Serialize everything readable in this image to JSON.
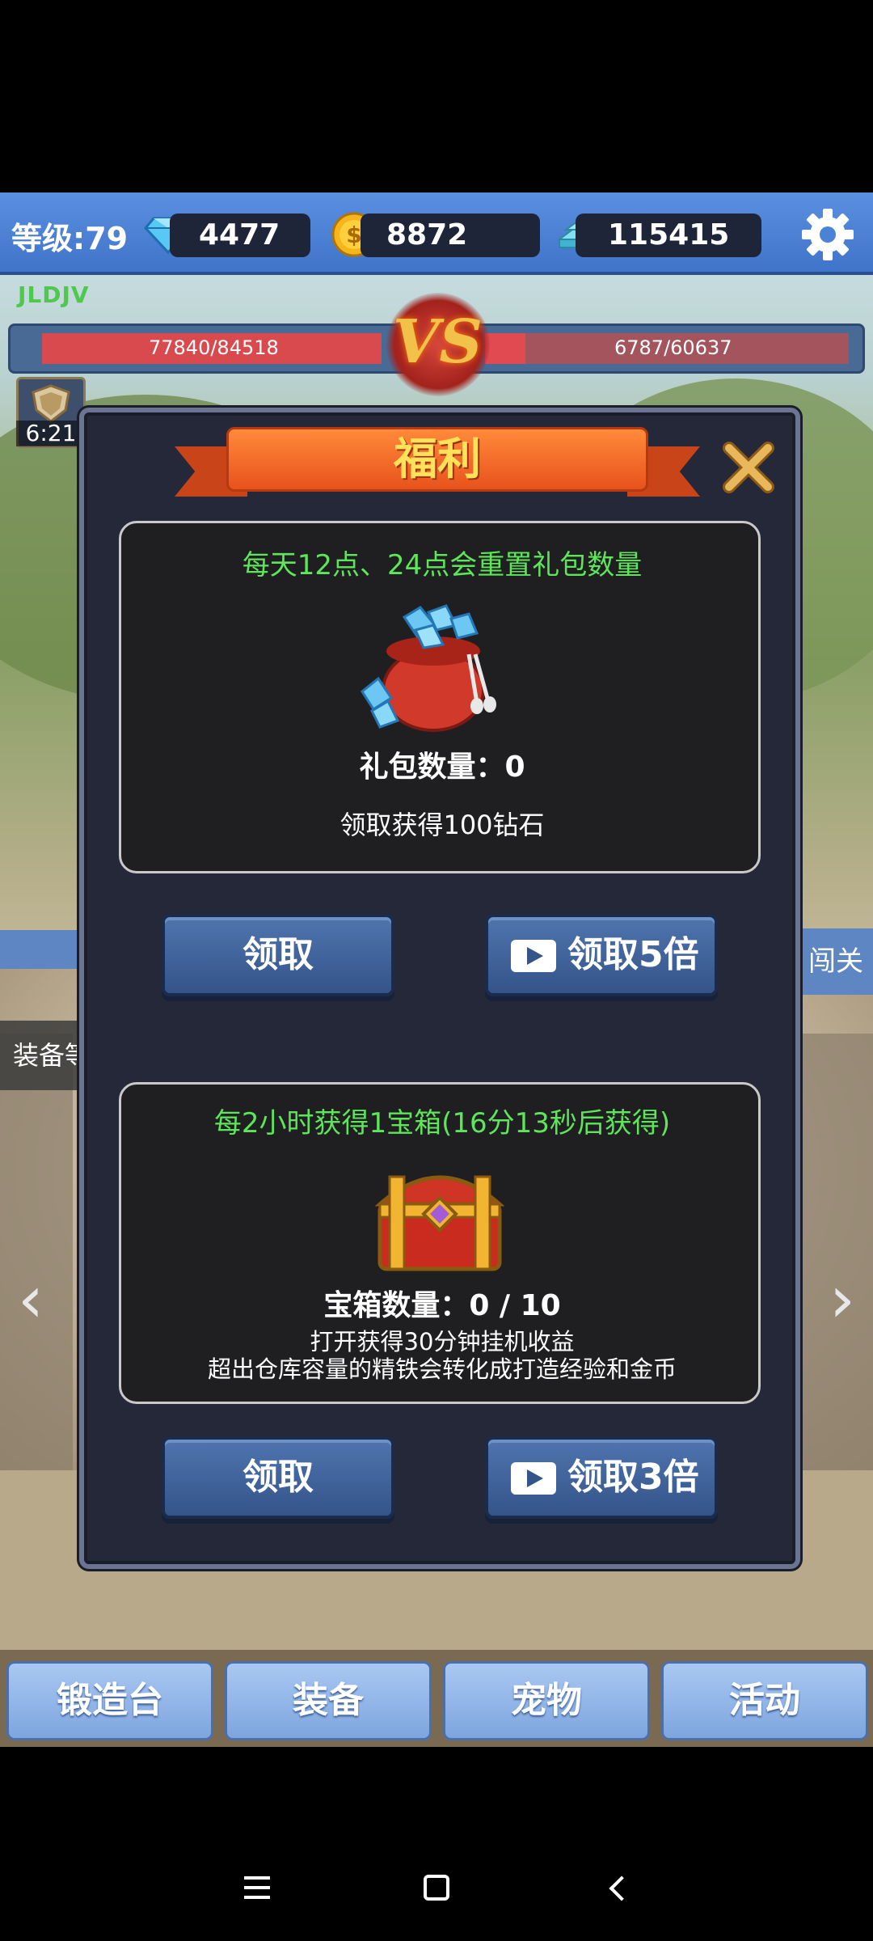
{
  "topbar": {
    "level": "等级:79",
    "diamonds": "4477",
    "gold": "8872",
    "iron": "115415"
  },
  "battle": {
    "enemy_name": "JLDJV",
    "left_hp": "77840/84518",
    "right_hp": "6787/60637",
    "vs_label": "VS",
    "shield_timer": "6:21"
  },
  "background": {
    "left_tag": "装备等",
    "right_tag": "闯关"
  },
  "modal": {
    "title": "福利",
    "gift": {
      "hint": "每天12点、24点会重置礼包数量",
      "count": "礼包数量：0",
      "desc": "领取获得100钻石",
      "claim": "领取",
      "claim_multi": "领取5倍"
    },
    "chest": {
      "hint": "每2小时获得1宝箱(16分13秒后获得)",
      "count": "宝箱数量：0 / 10",
      "desc1": "打开获得30分钟挂机收益",
      "desc2": "超出仓库容量的精铁会转化成打造经验和金币",
      "claim": "领取",
      "claim_multi": "领取3倍"
    }
  },
  "bottom_nav": [
    "锻造台",
    "装备",
    "宠物",
    "活动"
  ],
  "icons": {
    "diamond": "diamond-icon",
    "gold": "gold-coin-icon",
    "iron": "iron-ingot-icon",
    "settings": "gear-icon",
    "close": "close-icon",
    "video": "video-play-icon",
    "gift_bag": "diamond-bag-icon",
    "chest": "treasure-chest-icon"
  },
  "colors": {
    "topbar": "#4a82d6",
    "hint_green": "#5ee65a",
    "ribbon": "#f06a26",
    "title_yellow": "#ffe15a",
    "button_blue": "#3f62a0"
  }
}
